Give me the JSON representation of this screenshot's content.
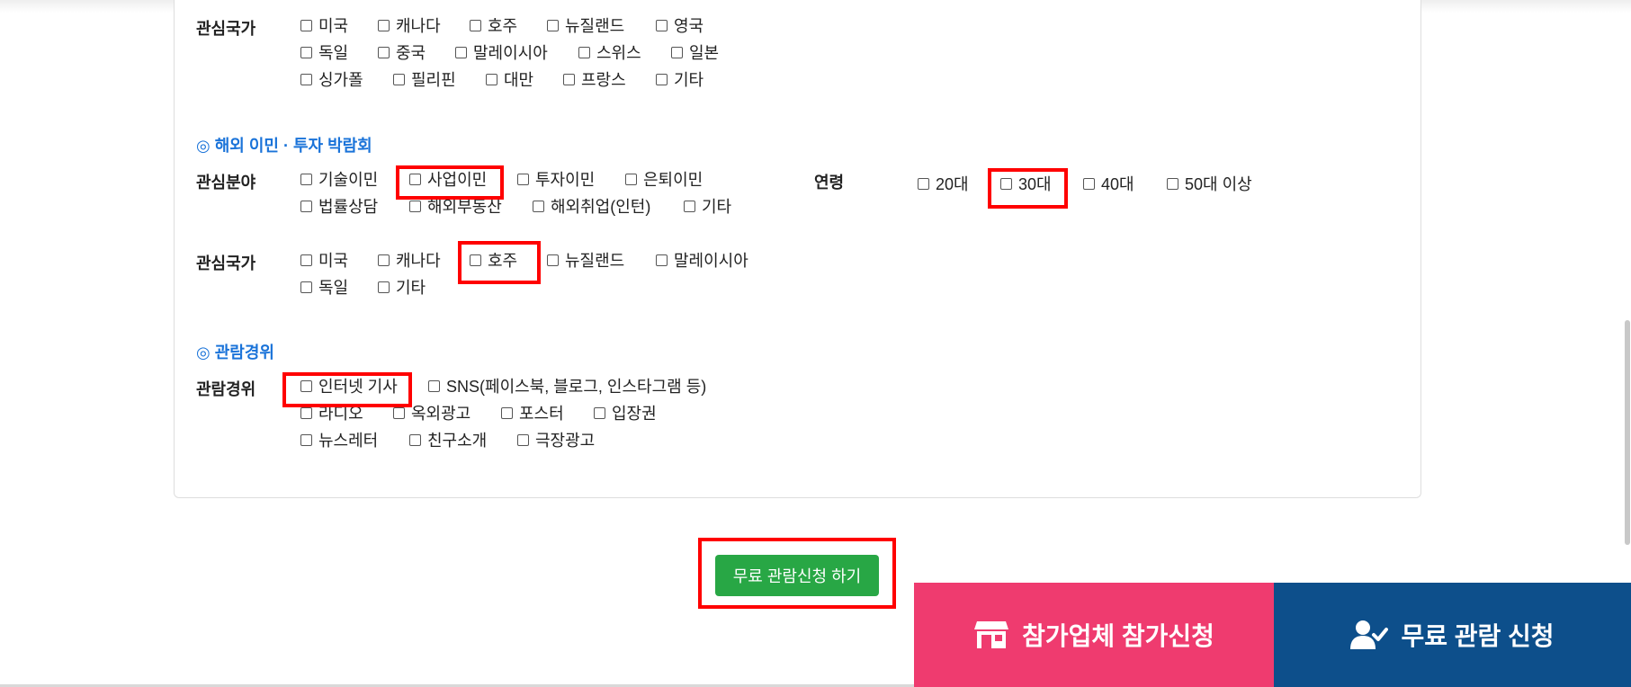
{
  "interest_country_1": {
    "label": "관심국가",
    "options": [
      "미국",
      "캐나다",
      "호주",
      "뉴질랜드",
      "영국",
      "독일",
      "중국",
      "말레이시아",
      "스위스",
      "일본",
      "싱가폴",
      "필리핀",
      "대만",
      "프랑스",
      "기타"
    ]
  },
  "immigration_expo": {
    "title": "◎ 해외 이민 · 투자 박람회",
    "field": {
      "label": "관심분야",
      "options": [
        "기술이민",
        "사업이민",
        "투자이민",
        "은퇴이민",
        "법률상담",
        "해외부동산",
        "해외취업(인턴)",
        "기타"
      ]
    },
    "age": {
      "label": "연령",
      "options": [
        "20대",
        "30대",
        "40대",
        "50대 이상"
      ]
    },
    "country": {
      "label": "관심국가",
      "options": [
        "미국",
        "캐나다",
        "호주",
        "뉴질랜드",
        "말레이시아",
        "독일",
        "기타"
      ]
    }
  },
  "visit_path": {
    "title": "◎ 관람경위",
    "label": "관람경위",
    "options": [
      "인터넷 기사",
      "SNS(페이스북, 블로그, 인스타그램 등)",
      "라디오",
      "옥외광고",
      "포스터",
      "입장권",
      "뉴스레터",
      "친구소개",
      "극장광고"
    ]
  },
  "submit_label": "무료 관람신청 하기",
  "exhibitor_apply_label": "참가업체 참가신청",
  "free_visit_apply_label": "무료 관람 신청",
  "colors": {
    "section_title": "#1a73d9",
    "submit_button": "#28a745",
    "exhibitor_bar": "#ef3b6f",
    "visit_bar": "#0d4f8b",
    "highlight": "#ff0000"
  },
  "icons": {
    "exhibitor": "store-icon",
    "visit": "user-check-icon"
  }
}
